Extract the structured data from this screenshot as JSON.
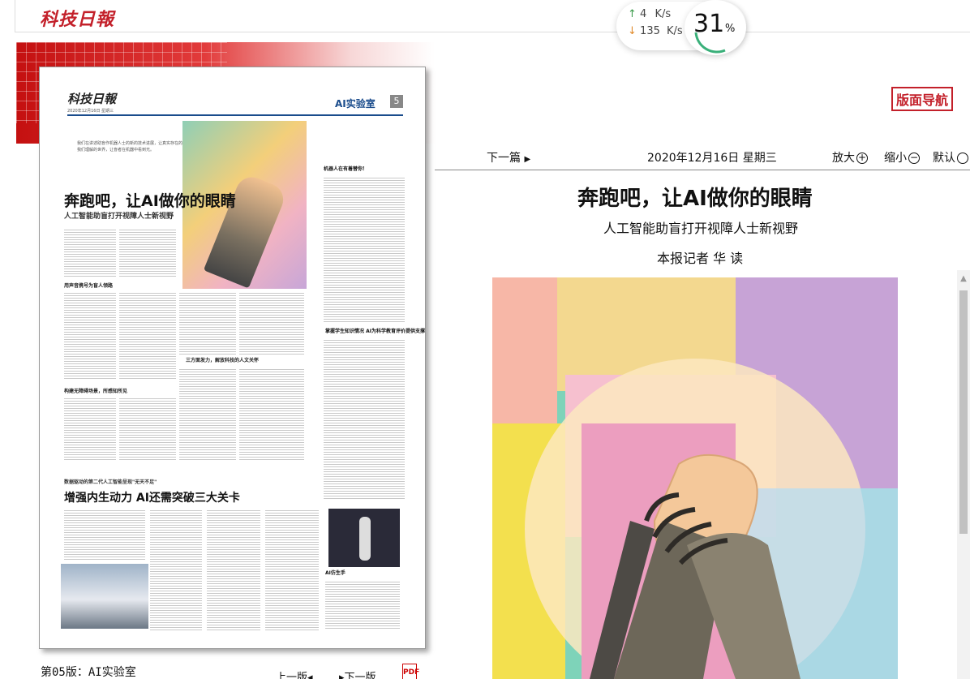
{
  "header": {
    "logo_text": "科技日報"
  },
  "speed_widget": {
    "upload": "4",
    "upload_unit": "K/s",
    "download": "135",
    "download_unit": "K/s",
    "percent": "31",
    "percent_sign": "%"
  },
  "page_thumbnail": {
    "logo": "科技日報",
    "section_label": "AI实验室",
    "page_number": "5",
    "quote": "我们在讲述助盲作机器人士的新的技术进展，让真实存在的我们理解的世界，让盲者在机器中看到光。",
    "headline": "奔跑吧，让AI做你的眼睛",
    "subheadline": "人工智能助盲打开视障人士新视野",
    "subhead_1": "用声音携号为盲人领路",
    "subhead_2": "构建无障碍场景，所感知所见",
    "subhead_3": "三方面发力，解放科技的人文关怀",
    "side_q1": "机器人在有着替你！",
    "side_q2": "掌握学生知识情况 AI为科学教育评价提供支撑",
    "side_q3": "AI仿生手",
    "kicker_2": "数据驱动的第二代人工智能呈现\"无天不足\"",
    "headline_2": "增强内生动力  AI还需突破三大关卡"
  },
  "footer": {
    "page_label": "第05版：AI实验室",
    "prev_page": "上一版",
    "next_page": "下一版",
    "pdf": "PDF"
  },
  "nav_button": "版面导航",
  "toolbar": {
    "prev_article": "下一篇",
    "date": "2020年12月16日  星期三",
    "zoom_in": "放大",
    "zoom_out": "缩小",
    "default": "默认"
  },
  "article": {
    "title": "奔跑吧，让AI做你的眼睛",
    "subtitle": "人工智能助盲打开视障人士新视野",
    "author": "本报记者  华  读"
  },
  "colors": {
    "brand_red": "#c3202a",
    "accent_blue": "#1a4c8c",
    "speed_up": "#3a9a4a",
    "speed_down": "#e08a2a"
  },
  "icons": [
    "play-arrow-icon",
    "zoom-in-icon",
    "zoom-out-icon",
    "pdf-icon",
    "up-arrow-icon",
    "down-arrow-icon"
  ]
}
